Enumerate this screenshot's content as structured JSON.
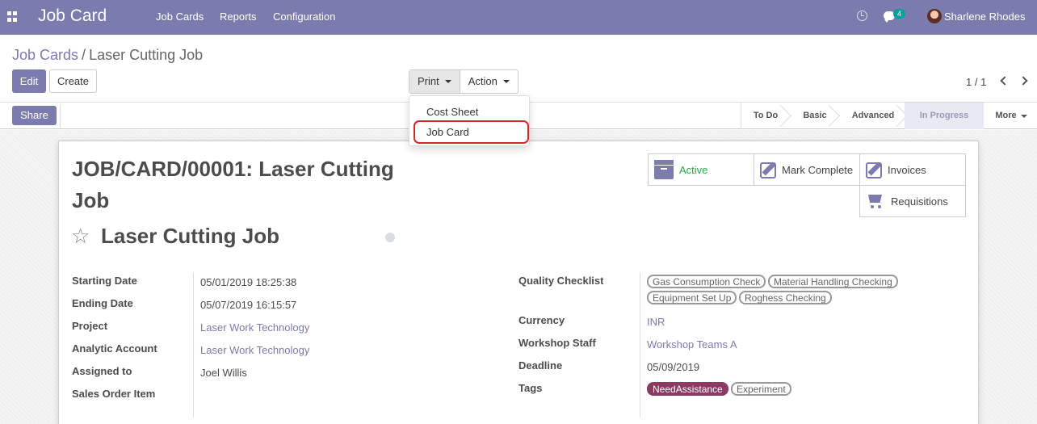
{
  "navbar": {
    "app_name": "Job Card",
    "menu": [
      "Job Cards",
      "Reports",
      "Configuration"
    ],
    "chat_count": "4",
    "user_name": "Sharlene Rhodes"
  },
  "breadcrumb": {
    "parent": "Job Cards",
    "separator": "/",
    "current": "Laser Cutting Job"
  },
  "buttons": {
    "edit": "Edit",
    "create": "Create",
    "print": "Print",
    "action": "Action",
    "share": "Share"
  },
  "pager": {
    "value": "1 / 1"
  },
  "print_menu": {
    "items": [
      "Cost Sheet",
      "Job Card"
    ],
    "highlighted": "Job Card"
  },
  "stages": {
    "items": [
      "To Do",
      "Basic",
      "Advanced",
      "In Progress"
    ],
    "active": "In Progress",
    "more": "More"
  },
  "record": {
    "title": "JOB/CARD/00001: Laser Cutting Job",
    "name": "Laser Cutting Job"
  },
  "smart_buttons": {
    "active": "Active",
    "mark_complete": "Mark Complete",
    "invoices": "Invoices",
    "requisitions": "Requisitions"
  },
  "left_fields": {
    "starting_date": {
      "label": "Starting Date",
      "value": "05/01/2019 18:25:38"
    },
    "ending_date": {
      "label": "Ending Date",
      "value": "05/07/2019 16:15:57"
    },
    "project": {
      "label": "Project",
      "value": "Laser Work Technology"
    },
    "analytic_account": {
      "label": "Analytic Account",
      "value": "Laser Work Technology"
    },
    "assigned_to": {
      "label": "Assigned to",
      "value": "Joel Willis"
    },
    "sales_order_item": {
      "label": "Sales Order Item",
      "value": ""
    }
  },
  "right_fields": {
    "quality_checklist": {
      "label": "Quality Checklist",
      "tags": [
        "Gas Consumption Check",
        "Material Handling Checking",
        "Equipment Set Up",
        "Roghess Checking"
      ]
    },
    "currency": {
      "label": "Currency",
      "value": "INR"
    },
    "workshop_staff": {
      "label": "Workshop Staff",
      "value": "Workshop Teams A"
    },
    "deadline": {
      "label": "Deadline",
      "value": "05/09/2019"
    },
    "tags": {
      "label": "Tags",
      "items": [
        "NeedAssistance",
        "Experiment"
      ]
    }
  },
  "colors": {
    "brand": "#7c7bad",
    "highlight": "#d7262b",
    "active_green": "#28a745",
    "tag_fill": "#8b3a62"
  }
}
